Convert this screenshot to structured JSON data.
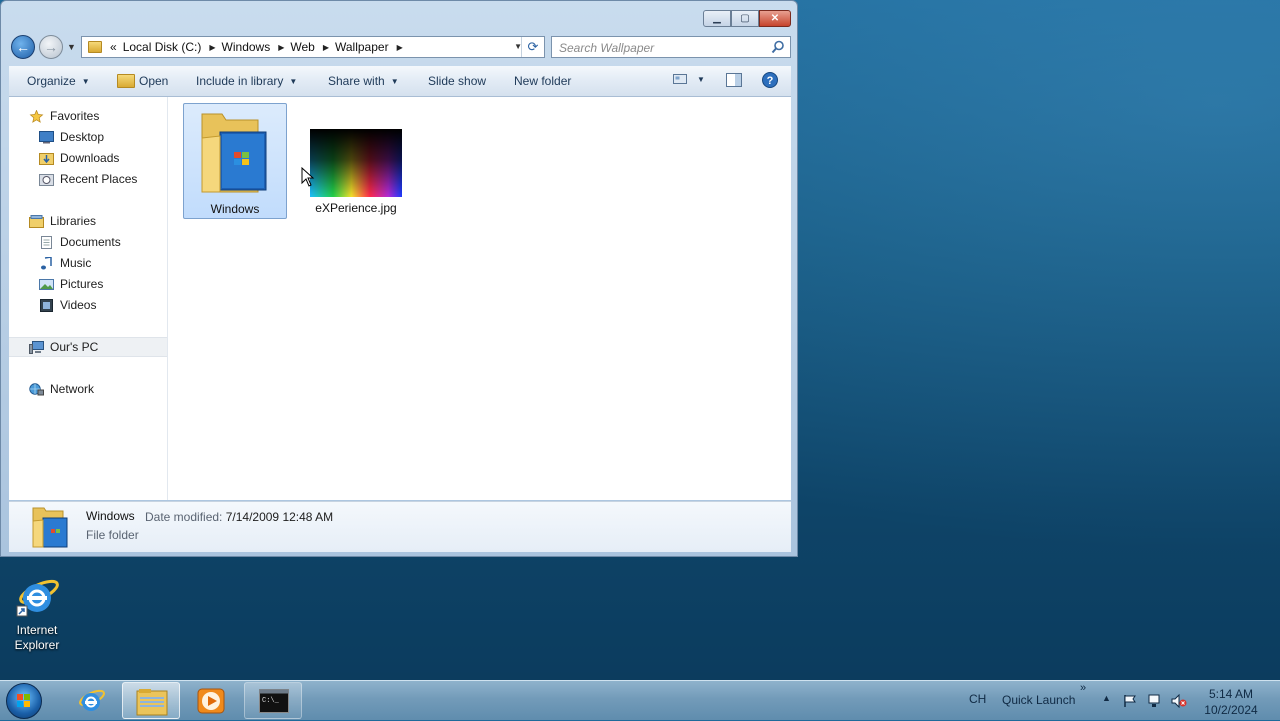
{
  "window": {
    "address": {
      "overflow_glyph": "«",
      "segments": [
        "Local Disk (C:)",
        "Windows",
        "Web",
        "Wallpaper"
      ]
    },
    "search_placeholder": "Search Wallpaper",
    "toolbar": {
      "organize": "Organize",
      "open": "Open",
      "include_in_library": "Include in library",
      "share_with": "Share with",
      "slide_show": "Slide show",
      "new_folder": "New folder"
    },
    "nav_pane": {
      "favorites": "Favorites",
      "desktop": "Desktop",
      "downloads": "Downloads",
      "recent_places": "Recent Places",
      "libraries": "Libraries",
      "documents": "Documents",
      "music": "Music",
      "pictures": "Pictures",
      "videos": "Videos",
      "computer": "Our's PC",
      "network": "Network"
    },
    "items": [
      {
        "name": "Windows",
        "selected": true
      },
      {
        "name": "eXPerience.jpg",
        "selected": false
      }
    ],
    "details": {
      "name": "Windows",
      "date_label": "Date modified:",
      "date_value": "7/14/2009 12:48 AM",
      "type": "File folder"
    }
  },
  "desktop": {
    "ie_label_line1": "Internet",
    "ie_label_line2": "Explorer"
  },
  "taskbar": {
    "language": "CH",
    "quick_launch": "Quick Launch",
    "quick_launch_chevron": "»",
    "time": "5:14 AM",
    "date": "10/2/2024"
  },
  "colors": {
    "accent_blue": "#1f5fa8",
    "close_red": "#c6442c",
    "selection": "#c1dcfc"
  }
}
